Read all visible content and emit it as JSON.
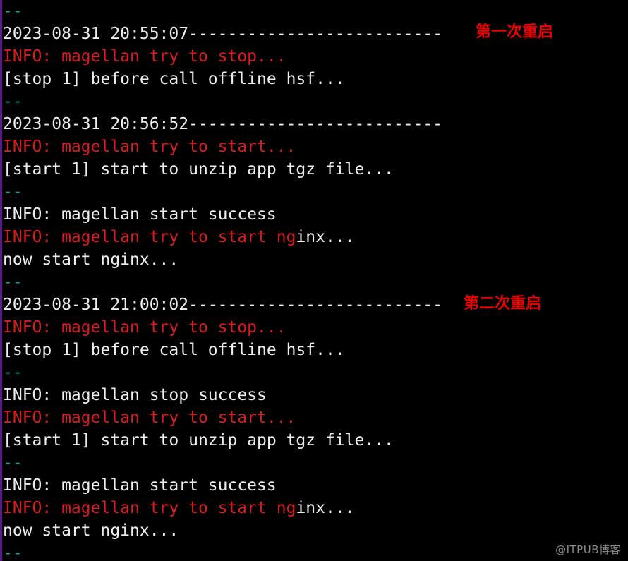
{
  "terminal": {
    "background_color": "#000000",
    "default_text_color": "#eeeeee",
    "ansi_red": "#d81b1b",
    "ansi_teal": "#10a090",
    "left_edge_color": "#5b1a8a",
    "separator": "--",
    "lines": [
      {
        "id": "l01",
        "segments": [
          {
            "text": "--",
            "color": "teal"
          }
        ]
      },
      {
        "id": "l02",
        "segments": [
          {
            "text": "2023-08-31 20:55:07--------------------------",
            "color": "white"
          }
        ]
      },
      {
        "id": "l03",
        "segments": [
          {
            "text": "INFO: magellan try to stop...",
            "color": "red"
          }
        ]
      },
      {
        "id": "l04",
        "segments": [
          {
            "text": "[stop 1] before call offline hsf...",
            "color": "white"
          }
        ]
      },
      {
        "id": "l05",
        "segments": [
          {
            "text": "--",
            "color": "teal"
          }
        ]
      },
      {
        "id": "l06",
        "segments": [
          {
            "text": "2023-08-31 20:56:52--------------------------",
            "color": "white"
          }
        ]
      },
      {
        "id": "l07",
        "segments": [
          {
            "text": "INFO: magellan try to start...",
            "color": "red"
          }
        ]
      },
      {
        "id": "l08",
        "segments": [
          {
            "text": "[start 1] start to unzip app tgz file...",
            "color": "white"
          }
        ]
      },
      {
        "id": "l09",
        "segments": [
          {
            "text": "--",
            "color": "teal"
          }
        ]
      },
      {
        "id": "l10",
        "segments": [
          {
            "text": "INFO: magellan start success",
            "color": "white"
          }
        ]
      },
      {
        "id": "l11",
        "segments": [
          {
            "text": "INFO: magellan try to start ng",
            "color": "red"
          },
          {
            "text": "inx...",
            "color": "white"
          }
        ]
      },
      {
        "id": "l12",
        "segments": [
          {
            "text": "now start nginx...",
            "color": "white"
          }
        ]
      },
      {
        "id": "l13",
        "segments": [
          {
            "text": "--",
            "color": "teal"
          }
        ]
      },
      {
        "id": "l14",
        "segments": [
          {
            "text": "2023-08-31 21:00:02--------------------------",
            "color": "white"
          }
        ]
      },
      {
        "id": "l15",
        "segments": [
          {
            "text": "INFO: magellan try to stop...",
            "color": "red"
          }
        ]
      },
      {
        "id": "l16",
        "segments": [
          {
            "text": "[stop 1] before call offline hsf...",
            "color": "white"
          }
        ]
      },
      {
        "id": "l17",
        "segments": [
          {
            "text": "--",
            "color": "teal"
          }
        ]
      },
      {
        "id": "l18",
        "segments": [
          {
            "text": "INFO: magellan stop success",
            "color": "white"
          }
        ]
      },
      {
        "id": "l19",
        "segments": [
          {
            "text": "INFO: magellan try to start...",
            "color": "red"
          }
        ]
      },
      {
        "id": "l20",
        "segments": [
          {
            "text": "[start 1] start to unzip app tgz file...",
            "color": "white"
          }
        ]
      },
      {
        "id": "l21",
        "segments": [
          {
            "text": "--",
            "color": "teal"
          }
        ]
      },
      {
        "id": "l22",
        "segments": [
          {
            "text": "INFO: magellan start success",
            "color": "white"
          }
        ]
      },
      {
        "id": "l23",
        "segments": [
          {
            "text": "INFO: magellan try to start ng",
            "color": "red"
          },
          {
            "text": "inx...",
            "color": "white"
          }
        ]
      },
      {
        "id": "l24",
        "segments": [
          {
            "text": "now start nginx...",
            "color": "white"
          }
        ]
      },
      {
        "id": "l25",
        "segments": [
          {
            "text": "--",
            "color": "teal"
          }
        ]
      }
    ]
  },
  "annotations": {
    "color": "#ee0000",
    "first_restart": "第一次重启",
    "second_restart": "第二次重启"
  },
  "watermark": {
    "text": "@ITPUB博客",
    "color": "#8a8a8a"
  }
}
